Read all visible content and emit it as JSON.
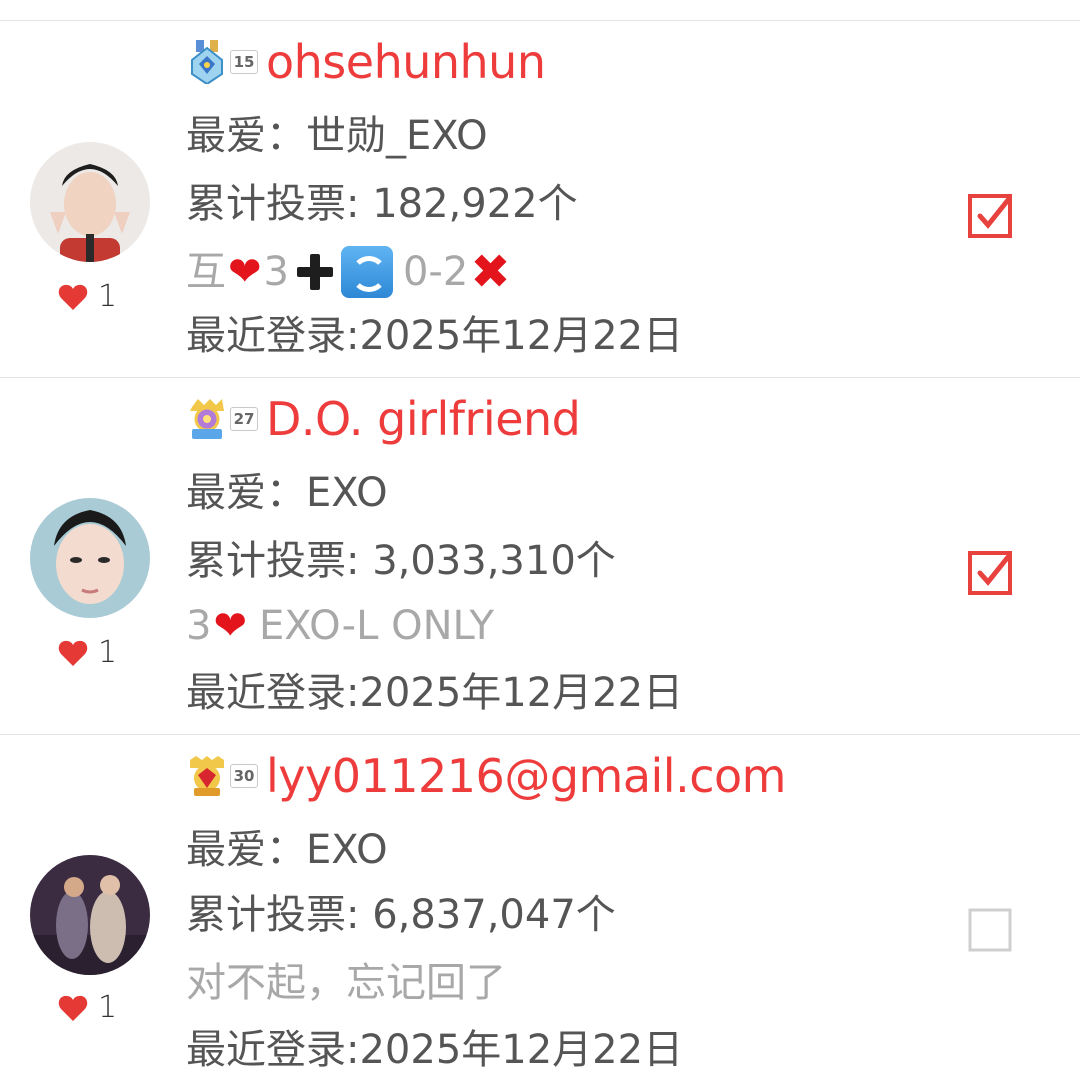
{
  "users": [
    {
      "level": "15",
      "username": "ohsehunhun",
      "favorite": "最爱：世勋_EXO",
      "votes": "累计投票: 182,922个",
      "status_parts": [
        "互",
        "❤",
        "3",
        "+",
        "cycle",
        "0-2",
        "✕"
      ],
      "status_text_a": "互",
      "status_text_b": "3",
      "status_text_c": "0-2",
      "last_login": "最近登录:2025年12月22日",
      "likes": "1",
      "checked": true,
      "avatar_colors": [
        "#f2d3c3",
        "#c23a32",
        "#222222"
      ]
    },
    {
      "level": "27",
      "username": "D.O. girlfriend",
      "favorite": "最爱：EXO",
      "votes": "累计投票: 3,033,310个",
      "status_text_a": "3",
      "status_text_b": "EXO-L ONLY",
      "last_login": "最近登录:2025年12月22日",
      "likes": "1",
      "checked": true,
      "avatar_colors": [
        "#f3dccf",
        "#a7c8d2",
        "#1c1c1c"
      ]
    },
    {
      "level": "30",
      "username": "lyy011216@gmail.com",
      "favorite": "最爱：EXO",
      "votes": "累计投票: 6,837,047个",
      "status_text_a": "对不起，忘记回了",
      "last_login": "最近登录:2025年12月22日",
      "likes": "1",
      "checked": false,
      "avatar_colors": [
        "#3a2a40",
        "#7a6f86",
        "#d9c9b9"
      ]
    }
  ],
  "icons": {
    "checkbox_checked_color": "#e8423e",
    "checkbox_unchecked_color": "#cfcfcf",
    "heart_color": "#e53935"
  }
}
